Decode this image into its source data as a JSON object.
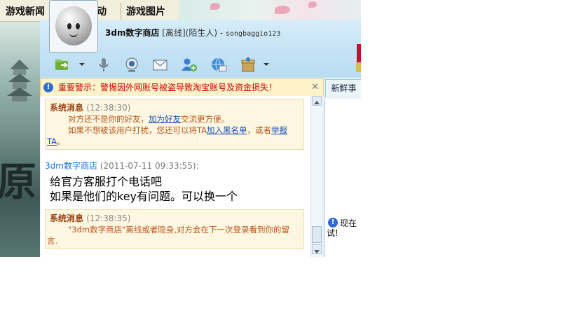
{
  "game_nav": {
    "tabs": [
      "游戏新闻",
      "动",
      "游戏图片"
    ]
  },
  "background": {
    "calligraphy": "原"
  },
  "chat": {
    "contact_name": "3dm数字商店",
    "status": "[离线]",
    "relation": "(陌生人)",
    "separator": " - ",
    "signature": "songbaggio123",
    "toolbar_icons": [
      "transfer-file-icon",
      "microphone-icon",
      "webcam-icon",
      "mail-icon",
      "add-friend-icon",
      "remote-assist-icon",
      "app-box-icon"
    ],
    "warning": "重要警示：警惕因外网账号被盗导致淘宝账号及资金损失！",
    "right_tab": "新鲜事",
    "side_notice_1": "现在",
    "side_notice_2": "试!",
    "messages": {
      "sys1": {
        "title": "系统消息",
        "time": "(12:38:30)",
        "line1_pre": "对方还不是你的好友，",
        "line1_link": "加为好友",
        "line1_post": "交流更方便。",
        "line2_pre": "如果不想被该用户打扰，您还可以将TA",
        "line2_link1": "加入黑名单",
        "line2_mid": "，或者",
        "line2_link2": "举报",
        "line3_link": "TA",
        "line3_post": "。"
      },
      "sender": "3dm数字商店",
      "sender_time": "(2011-07-11 09:33:55):",
      "msg1": "给官方客服打个电话吧",
      "msg2": "如果是他们的key有问题。可以换一个",
      "sys2": {
        "title": "系统消息",
        "time": "(12:38:35)",
        "line1": "\"3dm数字商店\"离线或者隐身,对方会在下一次登录看到你的留",
        "line2": "言."
      }
    }
  }
}
